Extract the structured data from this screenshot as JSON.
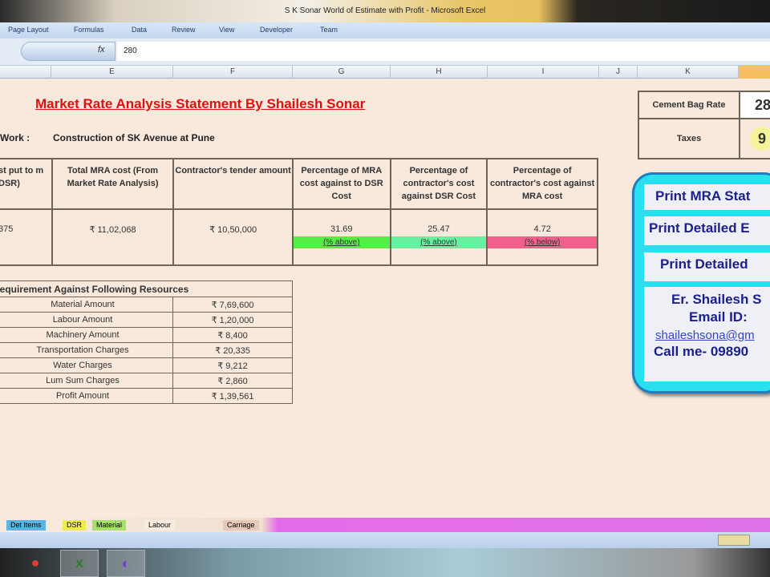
{
  "window": {
    "title": "S K Sonar World of Estimate with Profit - Microsoft Excel"
  },
  "ribbon": {
    "tabs": [
      "Page Layout",
      "Formulas",
      "Data",
      "Review",
      "View",
      "Developer",
      "Team"
    ]
  },
  "formula_bar": {
    "fx": "fx",
    "value": "280"
  },
  "columns": [
    "E",
    "F",
    "G",
    "H",
    "I",
    "J",
    "K"
  ],
  "sheet": {
    "title": "Market Rate Analysis Statement By Shailesh Sonar",
    "work_label": "Work :",
    "work_value": "Construction of SK Avenue at Pune",
    "main_table": {
      "headers": [
        "st put to m DSR)",
        "Total MRA cost (From Market Rate Analysis)",
        "Contractor's tender amount",
        "Percentage of MRA cost against to DSR Cost",
        "Percentage of contractor's cost against DSR Cost",
        "Percentage of contractor's cost against MRA cost"
      ],
      "values": [
        "375",
        "₹ 11,02,068",
        "₹ 10,50,000",
        "31.69",
        "25.47",
        "4.72"
      ],
      "badges": [
        {
          "label": "(% above)",
          "color": "#55ee44"
        },
        {
          "label": "(% above)",
          "color": "#66f0a0"
        },
        {
          "label": "(% below)",
          "color": "#f0608a"
        }
      ]
    },
    "resources": {
      "header": "Requirement Against Following Resources",
      "rows": [
        {
          "label": "Material Amount",
          "value": "₹ 7,69,600"
        },
        {
          "label": "Labour Amount",
          "value": "₹ 1,20,000"
        },
        {
          "label": "Machinery Amount",
          "value": "₹ 8,400"
        },
        {
          "label": "Transportation Charges",
          "value": "₹ 20,335"
        },
        {
          "label": "Water Charges",
          "value": "₹ 9,212"
        },
        {
          "label": "Lum Sum Charges",
          "value": "₹ 2,860"
        },
        {
          "label": "Profit Amount",
          "value": "₹ 1,39,561"
        }
      ]
    },
    "cement": {
      "label": "Cement Bag Rate",
      "value": "28",
      "taxes_label": "Taxes",
      "taxes_value": "9"
    },
    "panel": {
      "buttons": [
        "Print MRA Stat",
        "Print Detailed E",
        "Print Detailed"
      ],
      "contact_name": "Er. Shailesh S",
      "email_label": "Email ID:",
      "email": "shaileshsona@gm",
      "phone": "Call me- 09890"
    }
  },
  "sheet_tabs": [
    "Det Items",
    "DSR",
    "Material",
    "Labour",
    "Carriage"
  ],
  "taskbar": [
    "chrome",
    "excel",
    "app"
  ]
}
